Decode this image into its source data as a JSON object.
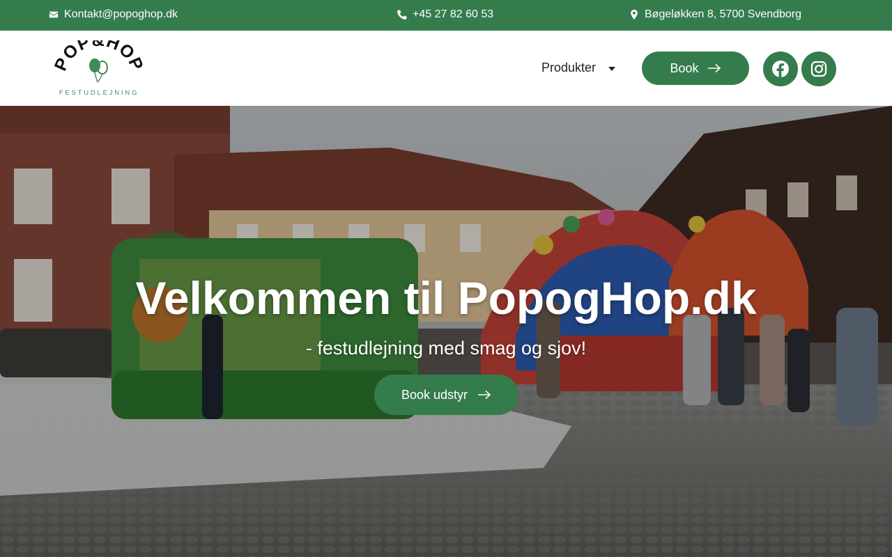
{
  "topbar": {
    "email": "Kontakt@popoghop.dk",
    "phone": "+45 27 82 60 53",
    "address": "Bøgeløkken 8, 5700 Svendborg"
  },
  "header": {
    "logo": {
      "line1": "POP&HOP",
      "line2": "FESTUDLEJNING"
    },
    "nav": {
      "produkter_label": "Produkter"
    },
    "book_label": "Book",
    "social": [
      "facebook-icon",
      "instagram-icon"
    ]
  },
  "hero": {
    "title": "Velkommen til PopogHop.dk",
    "subtitle": "- festudlejning med smag og sjov!",
    "cta_label": "Book udstyr"
  },
  "colors": {
    "brand_green": "#357c4d",
    "white": "#ffffff",
    "text_dark": "#222222"
  }
}
